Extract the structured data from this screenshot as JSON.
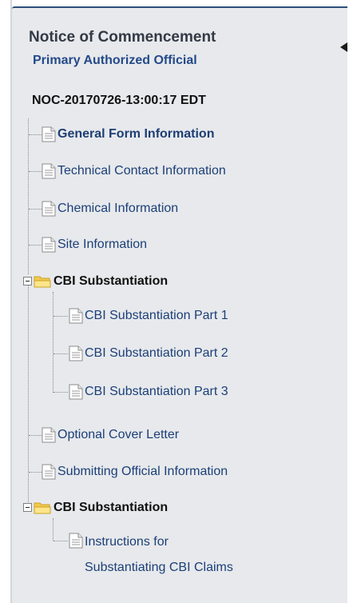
{
  "header": {
    "title": "Notice of Commencement",
    "subtitle": "Primary Authorized Official",
    "noc_id": "NOC-20170726-13:00:17 EDT"
  },
  "tree": {
    "items": [
      {
        "label": "General Form Information",
        "type": "document",
        "active": true
      },
      {
        "label": "Technical Contact Information",
        "type": "document"
      },
      {
        "label": "Chemical Information",
        "type": "document"
      },
      {
        "label": "Site Information",
        "type": "document"
      },
      {
        "label": "CBI Substantiation",
        "type": "folder",
        "expanded": true,
        "children": [
          {
            "label": "CBI Substantiation Part 1",
            "type": "document"
          },
          {
            "label": "CBI Substantiation Part 2",
            "type": "document"
          },
          {
            "label": "CBI Substantiation Part 3",
            "type": "document"
          }
        ]
      },
      {
        "label": "Optional Cover Letter",
        "type": "document"
      },
      {
        "label": "Submitting Official Information",
        "type": "document"
      },
      {
        "label": "CBI Substantiation",
        "type": "folder",
        "expanded": true,
        "children": [
          {
            "label_line1": "Instructions for",
            "label_line2": "Substantiating CBI Claims",
            "type": "document"
          }
        ]
      }
    ]
  },
  "icons": {
    "collapse": "chevron-left-icon",
    "document": "document-icon",
    "folder": "folder-open-icon",
    "expander": "collapse-minus-icon"
  },
  "colors": {
    "panel_bg": "#e7e9ec",
    "link": "#1c3f78",
    "title": "#333a45",
    "subtitle": "#244a8a"
  }
}
